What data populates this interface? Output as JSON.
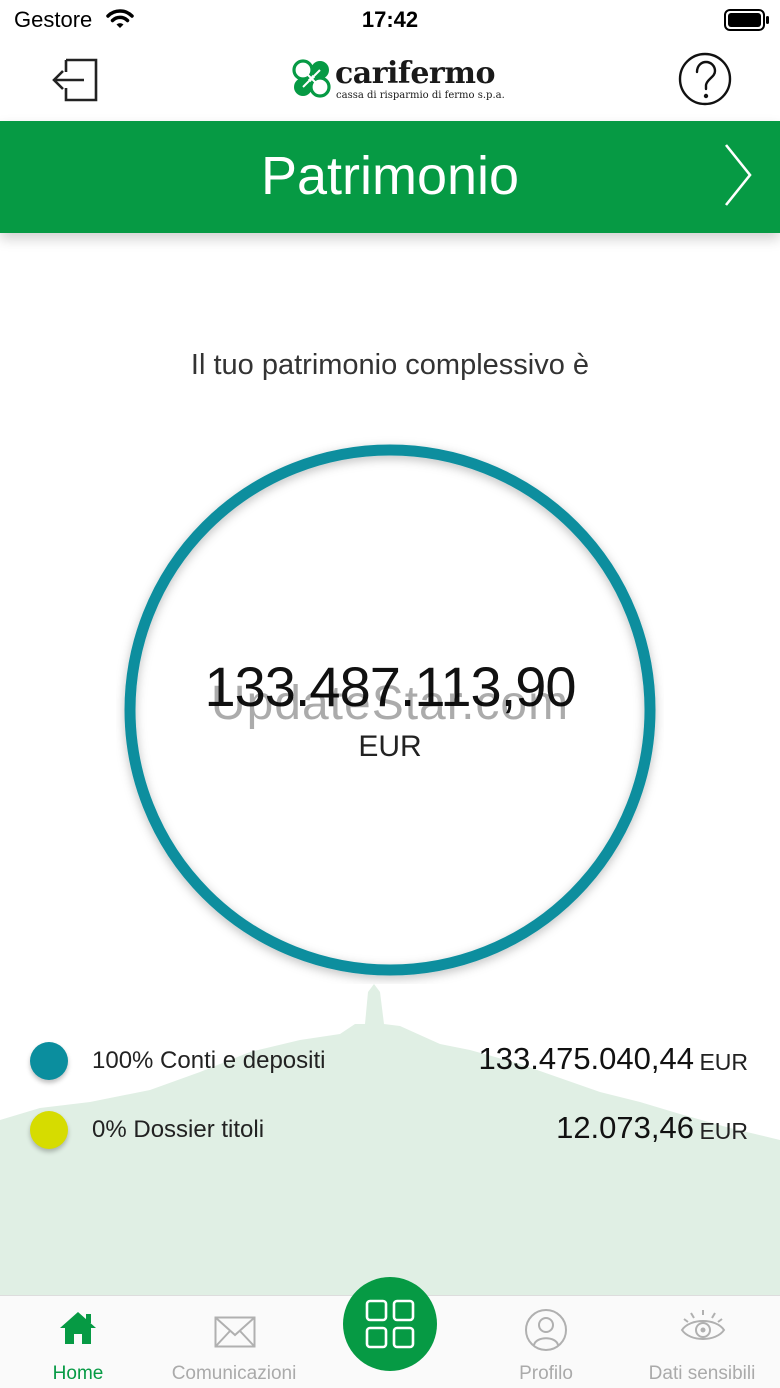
{
  "status_bar": {
    "carrier": "Gestore",
    "time": "17:42"
  },
  "header": {
    "logo_name": "carifermo",
    "logo_subtitle": "cassa di risparmio di fermo s.p.a.",
    "logout_icon": "logout-icon",
    "help_icon": "help-icon"
  },
  "title_band": {
    "title": "Patrimonio",
    "next_icon": "chevron-right-icon"
  },
  "summary": {
    "subtitle": "Il tuo patrimonio complessivo è",
    "total": "133.487.113,90",
    "currency": "EUR",
    "watermark": "UpdateStar.com"
  },
  "breakdown": [
    {
      "label": "100% Conti e depositi",
      "amount": "133.475.040,44",
      "currency": "EUR",
      "color": "#0b8e9e",
      "share": 100
    },
    {
      "label": "0% Dossier titoli",
      "amount": "12.073,46",
      "currency": "EUR",
      "color": "#d6dc00",
      "share": 0
    }
  ],
  "colors": {
    "brand_green": "#069a44",
    "ring": "#0b8e9e",
    "landscape": "#e0efe4"
  },
  "tabs": [
    {
      "label": "Home",
      "icon": "home-icon",
      "active": true
    },
    {
      "label": "Comunicazioni",
      "icon": "envelope-icon",
      "active": false
    },
    {
      "label": "",
      "icon": "grid-icon",
      "active": false
    },
    {
      "label": "Profilo",
      "icon": "profile-icon",
      "active": false
    },
    {
      "label": "Dati sensibili",
      "icon": "eye-icon",
      "active": false
    }
  ]
}
